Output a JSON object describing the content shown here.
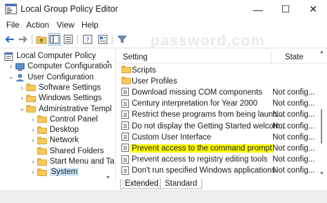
{
  "window": {
    "title": "Local Group Policy Editor",
    "controls": {
      "minimize": "—",
      "maximize": "☐",
      "close": "✕"
    }
  },
  "menu": [
    "File",
    "Action",
    "View",
    "Help"
  ],
  "toolbar": {
    "icons": [
      "back-arrow-icon",
      "forward-arrow-icon",
      "up-folder-icon",
      "show-hide-tree-icon",
      "export-list-icon",
      "help-icon",
      "properties-icon",
      "filter-icon"
    ]
  },
  "watermark": "password.com",
  "tree": {
    "items": [
      {
        "label": "Local Computer Policy",
        "level": 0,
        "chevron": ""
      },
      {
        "label": "Computer Configuration",
        "level": 1,
        "chevron": "›"
      },
      {
        "label": "User Configuration",
        "level": 1,
        "chevron": "⌄"
      },
      {
        "label": "Software Settings",
        "level": 2,
        "chevron": "›"
      },
      {
        "label": "Windows Settings",
        "level": 2,
        "chevron": "›"
      },
      {
        "label": "Administrative Templ",
        "level": 2,
        "chevron": "⌄"
      },
      {
        "label": "Control Panel",
        "level": 3,
        "chevron": "›"
      },
      {
        "label": "Desktop",
        "level": 3,
        "chevron": "›"
      },
      {
        "label": "Network",
        "level": 3,
        "chevron": "›"
      },
      {
        "label": "Shared Folders",
        "level": 3,
        "chevron": ""
      },
      {
        "label": "Start Menu and Ta",
        "level": 3,
        "chevron": "›"
      },
      {
        "label": "System",
        "level": 3,
        "chevron": "›",
        "selected": true
      }
    ]
  },
  "list": {
    "columns": {
      "setting": "Setting",
      "state": "State"
    },
    "rows": [
      {
        "name": "Scripts",
        "state": "",
        "type": "folder"
      },
      {
        "name": "User Profiles",
        "state": "",
        "type": "folder"
      },
      {
        "name": "Download missing COM components",
        "state": "Not config...",
        "type": "policy"
      },
      {
        "name": "Century interpretation for Year 2000",
        "state": "Not config...",
        "type": "policy"
      },
      {
        "name": "Restrict these programs from being launc...",
        "state": "Not config...",
        "type": "policy"
      },
      {
        "name": "Do not display the Getting Started welcom...",
        "state": "Not config...",
        "type": "policy"
      },
      {
        "name": "Custom User Interface",
        "state": "Not config...",
        "type": "policy"
      },
      {
        "name": "Prevent access to the command prompt",
        "state": "Not config...",
        "type": "policy",
        "highlight": true
      },
      {
        "name": "Prevent access to registry editing tools",
        "state": "Not config...",
        "type": "policy"
      },
      {
        "name": "Don't run specified Windows applications",
        "state": "Not config...",
        "type": "policy"
      }
    ]
  },
  "tabs": [
    {
      "label": "Extended",
      "active": false
    },
    {
      "label": "Standard",
      "active": true
    }
  ],
  "colors": {
    "highlight": "#ffff00",
    "selection": "#cde8ff",
    "folder": "#f6c95b"
  }
}
